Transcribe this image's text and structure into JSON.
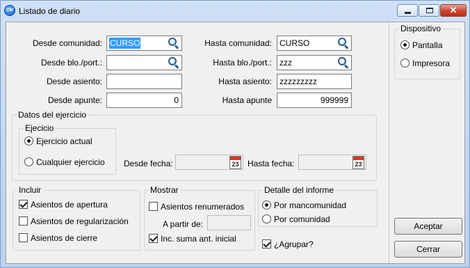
{
  "window": {
    "title": "Listado de diario",
    "icon": "cw-app-icon",
    "controls": {
      "minimize": "minimize-icon",
      "maximize": "maximize-icon",
      "close": "✕"
    }
  },
  "range": {
    "desde_comunidad": {
      "label": "Desde comunidad:",
      "value": "CURSO"
    },
    "hasta_comunidad": {
      "label": "Hasta comunidad:",
      "value": "CURSO"
    },
    "desde_bloque": {
      "label": "Desde blo./port.:",
      "value": ""
    },
    "hasta_bloque": {
      "label": "Hasta blo./port.:",
      "value": "zzz"
    },
    "desde_asiento": {
      "label": "Desde asiento:",
      "value": ""
    },
    "hasta_asiento": {
      "label": "Hasta asiento:",
      "value": "zzzzzzzzz"
    },
    "desde_apunte": {
      "label": "Desde apunte:",
      "value": "0"
    },
    "hasta_apunte": {
      "label": "Hasta apunte",
      "value": "999999"
    }
  },
  "datos_ejercicio": {
    "legend": "Datos del ejercicio",
    "ejercicio": {
      "legend": "Ejecicio",
      "options": [
        {
          "label": "Ejercicio actual",
          "selected": true
        },
        {
          "label": "Cualquier ejercicio",
          "selected": false
        }
      ]
    },
    "desde_fecha": {
      "label": "Desde fecha:",
      "value": ""
    },
    "hasta_fecha": {
      "label": "Hasta fecha:",
      "value": ""
    },
    "calendar_day": "23"
  },
  "incluir": {
    "legend": "Incluir",
    "items": [
      {
        "label": "Asientos de apertura",
        "checked": true
      },
      {
        "label": "Asientos de regularización",
        "checked": false
      },
      {
        "label": "Asientos de cierre",
        "checked": false
      }
    ]
  },
  "mostrar": {
    "legend": "Mostrar",
    "renumerados": {
      "label": "Asientos renumerados",
      "checked": false
    },
    "a_partir_de": {
      "label": "A partir de:",
      "value": ""
    },
    "inc_suma": {
      "label": "Inc. suma ant. inicial",
      "checked": true
    }
  },
  "detalle": {
    "legend": "Detalle del informe",
    "options": [
      {
        "label": "Por mancomunidad",
        "selected": true
      },
      {
        "label": "Por comunidad",
        "selected": false
      }
    ],
    "agrupar": {
      "label": "¿Agrupar?",
      "checked": true
    }
  },
  "dispositivo": {
    "legend": "Dispositivo",
    "options": [
      {
        "label": "Pantalla",
        "selected": true
      },
      {
        "label": "Impresora",
        "selected": false
      }
    ]
  },
  "buttons": {
    "aceptar": "Aceptar",
    "cerrar": "Cerrar"
  }
}
